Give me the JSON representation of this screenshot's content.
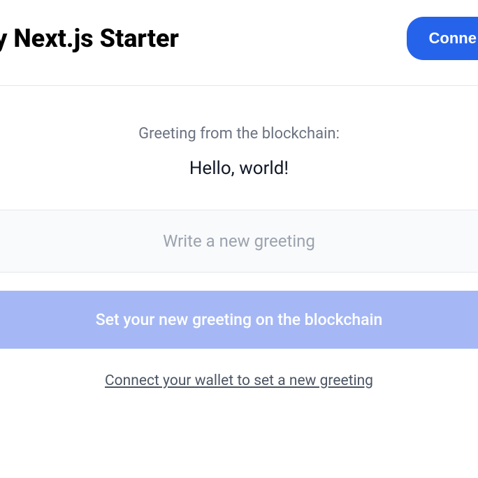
{
  "header": {
    "title": "idity Next.js Starter",
    "connect_button": "Conne"
  },
  "greeting": {
    "label": "Greeting from the blockchain:",
    "value": "Hello, world!"
  },
  "input": {
    "placeholder": "Write a new greeting"
  },
  "submit": {
    "label": "Set your new greeting on the blockchain"
  },
  "connect_link": {
    "label": "Connect your wallet to set a new greeting"
  }
}
